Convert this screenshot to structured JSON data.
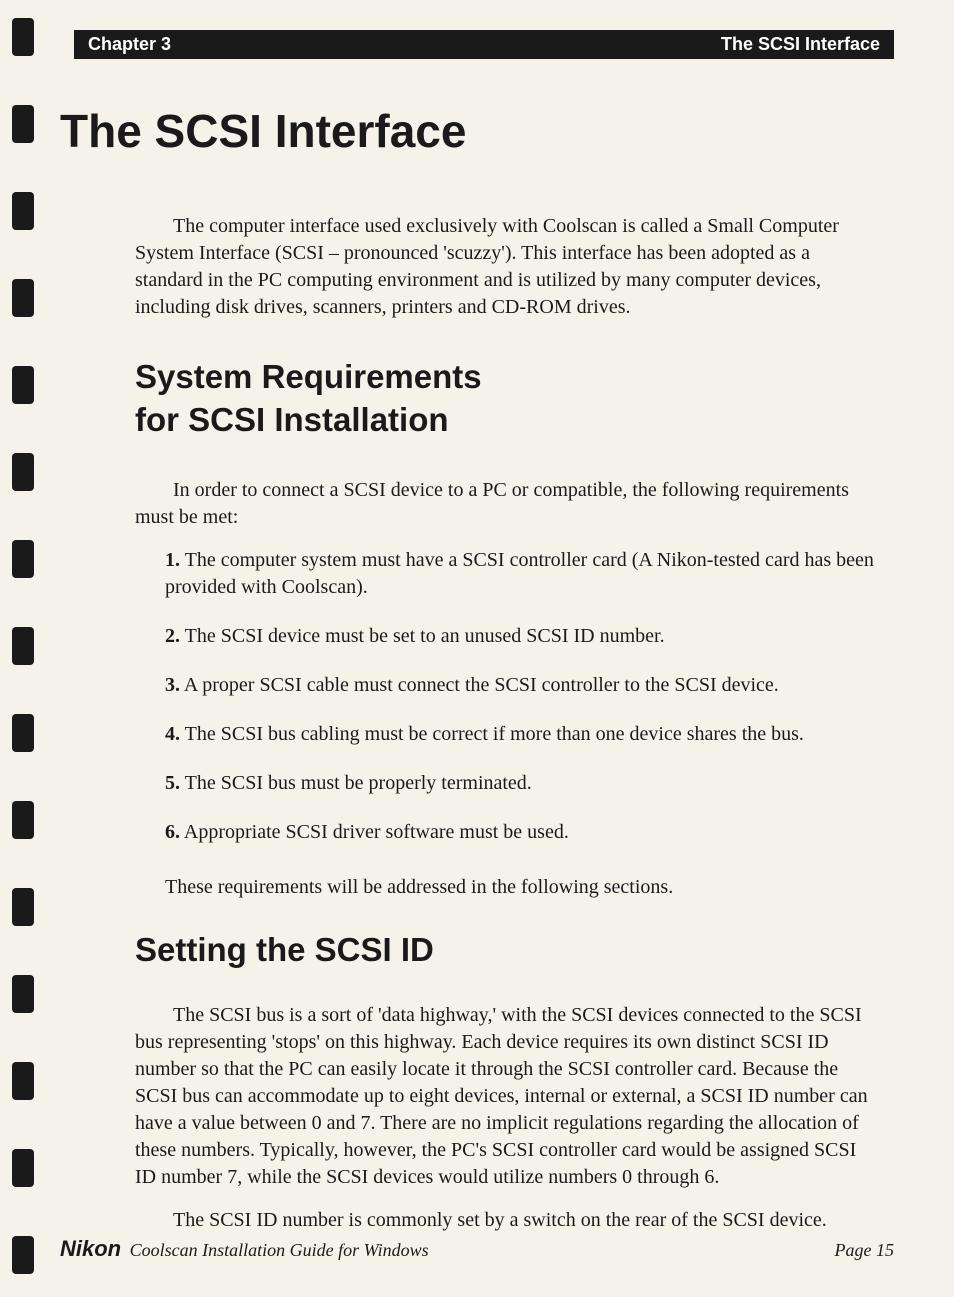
{
  "header": {
    "chapter": "Chapter 3",
    "title": "The SCSI Interface"
  },
  "main_title": "The SCSI Interface",
  "intro_paragraph": "The computer interface used exclusively with Coolscan is called a Small Computer System Interface (SCSI – pronounced 'scuzzy'). This interface has been adopted as a standard in the PC computing environment and is utilized by many computer devices, including disk drives, scanners, printers and CD-ROM drives.",
  "section1": {
    "heading_line1": "System Requirements",
    "heading_line2": "for SCSI Installation",
    "intro": "In order to connect a SCSI device to a PC or compatible, the following requirements must be met:",
    "items": [
      "The computer system must have a SCSI controller card (A Nikon-tested card has been provided with Coolscan).",
      "The SCSI device must be set to an unused SCSI ID number.",
      "A proper SCSI cable must connect the SCSI controller to the SCSI device.",
      "The SCSI bus cabling must be correct if more than one device shares the bus.",
      "The SCSI bus must be properly terminated.",
      "Appropriate SCSI driver software must be used."
    ],
    "outro": "These requirements will be addressed in the following sections."
  },
  "section2": {
    "heading": "Setting the SCSI ID",
    "paragraph1": "The SCSI bus is a sort of 'data highway,' with the SCSI devices connected to the SCSI bus representing 'stops' on this highway. Each device requires its own distinct SCSI ID number so that the PC can easily locate it through the SCSI controller card. Because the SCSI bus can accommodate up to eight devices, internal or external, a SCSI ID number can have a value between 0 and 7. There are no implicit regulations regarding the allocation of these numbers. Typically, however, the PC's SCSI controller card would be assigned SCSI ID number 7, while the SCSI devices would utilize numbers 0 through 6.",
    "paragraph2": "The SCSI ID number is commonly set by a switch on the rear of the SCSI device."
  },
  "footer": {
    "brand": "Nikon",
    "title": "Coolscan Installation Guide for Windows",
    "page": "Page 15"
  }
}
